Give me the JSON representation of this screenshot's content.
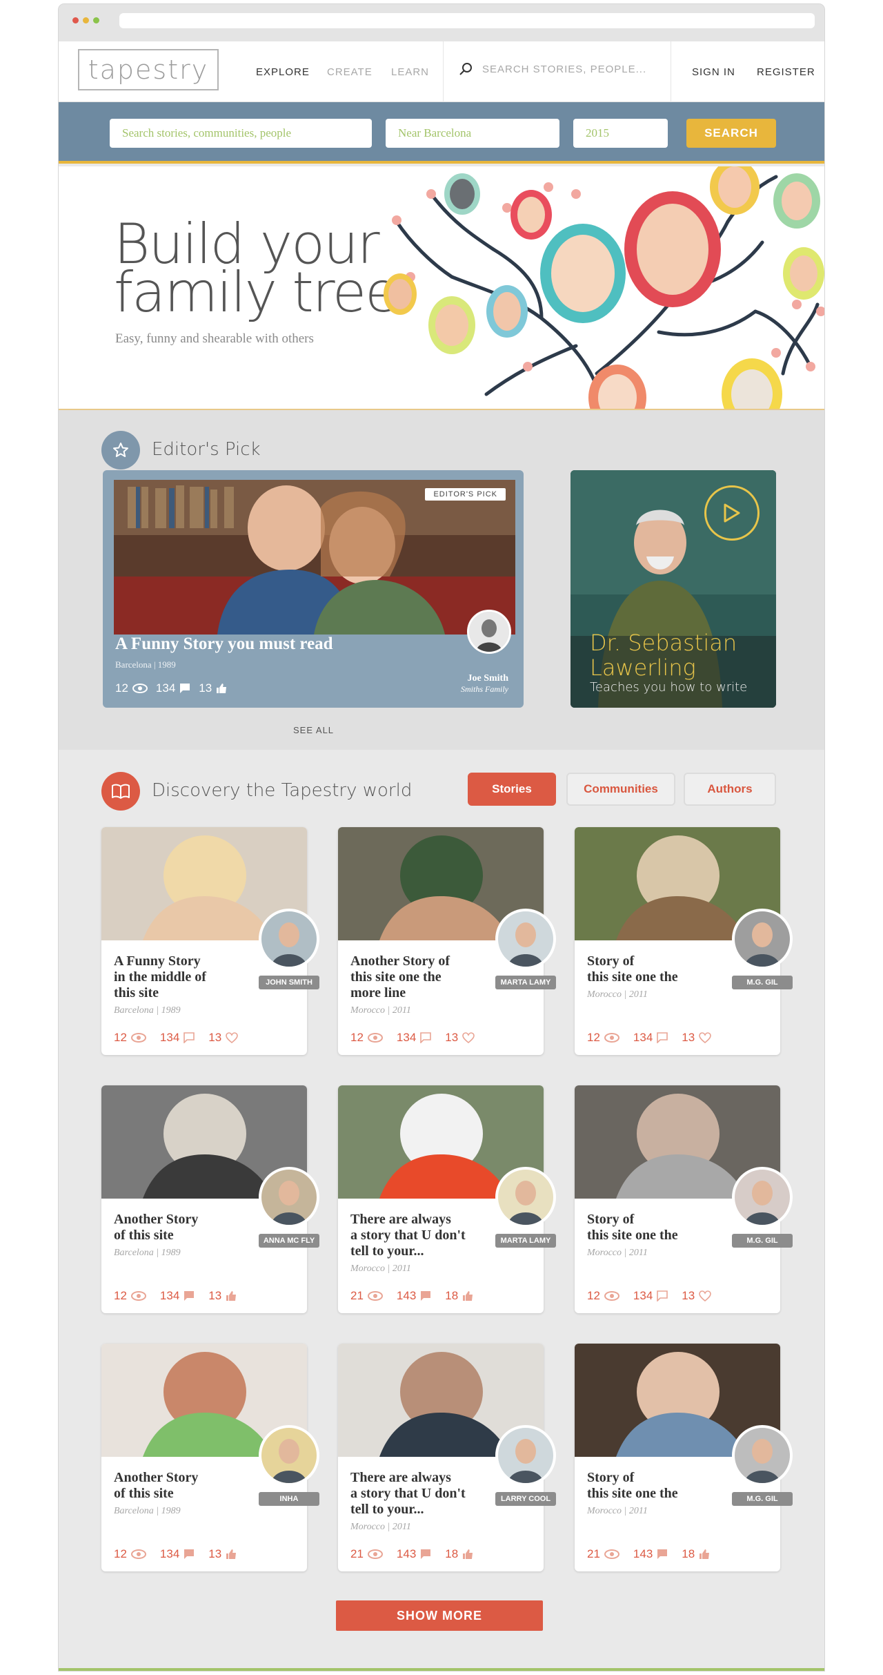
{
  "brand": {
    "logo": "tapestry"
  },
  "nav": {
    "items": [
      {
        "label": "EXPLORE"
      },
      {
        "label": "CREATE"
      },
      {
        "label": "LEARN"
      }
    ],
    "search_placeholder": "SEARCH STORIES, PEOPLE...",
    "sign_in": "SIGN IN",
    "register": "REGISTER"
  },
  "filters": {
    "query_placeholder": "Search stories, communities, people",
    "location_placeholder": "Near Barcelona",
    "year_placeholder": "2015",
    "search_button": "SEARCH"
  },
  "hero": {
    "title": "Build your\nfamily tree",
    "subtitle": "Easy, funny and shearable with others"
  },
  "editors_pick": {
    "heading": "Editor's Pick",
    "featured": {
      "badge": "EDITOR'S PICK",
      "title": "A Funny Story you must read",
      "meta": "Barcelona | 1989",
      "views": "12",
      "comments": "134",
      "likes": "13",
      "author_name": "Joe Smith",
      "author_family": "Smiths Family"
    },
    "video": {
      "name": "Dr. Sebastian\nLawerling",
      "subtitle": "Teaches you how to write"
    },
    "see_all": "SEE ALL"
  },
  "discover": {
    "heading": "Discovery the Tapestry world",
    "tabs": [
      "Stories",
      "Communities",
      "Authors"
    ],
    "cards": [
      {
        "title": "A Funny Story\nin the middle of\nthis site",
        "meta": "Barcelona | 1989",
        "author": "JOHN SMITH",
        "views": "12",
        "comments": "134",
        "likes": "13"
      },
      {
        "title": "Another Story of\nthis site one the\nmore line",
        "meta": "Morocco | 2011",
        "author": "MARTA LAMY",
        "views": "12",
        "comments": "134",
        "likes": "13"
      },
      {
        "title": "Story of\nthis site one the",
        "meta": "Morocco | 2011",
        "author": "M.G. GIL",
        "views": "12",
        "comments": "134",
        "likes": "13"
      },
      {
        "title": "Another Story\nof this site",
        "meta": "Barcelona | 1989",
        "author": "ANNA MC FLY",
        "views": "12",
        "comments": "134",
        "likes": "13"
      },
      {
        "title": "There are always\na story that U don't\ntell to your...",
        "meta": "Morocco | 2011",
        "author": "MARTA LAMY",
        "views": "21",
        "comments": "143",
        "likes": "18"
      },
      {
        "title": "Story of\nthis site one the",
        "meta": "Morocco | 2011",
        "author": "M.G. GIL",
        "views": "12",
        "comments": "134",
        "likes": "13"
      },
      {
        "title": "Another Story\nof this site",
        "meta": "Barcelona | 1989",
        "author": "INHA",
        "views": "12",
        "comments": "134",
        "likes": "13"
      },
      {
        "title": "There are always\na story that U don't\ntell to your...",
        "meta": "Morocco | 2011",
        "author": "LARRY COOL",
        "views": "21",
        "comments": "143",
        "likes": "18"
      },
      {
        "title": "Story of\nthis site one the",
        "meta": "Morocco | 2011",
        "author": "M.G. GIL",
        "views": "21",
        "comments": "143",
        "likes": "18"
      }
    ],
    "show_more": "SHOW MORE"
  },
  "colors": {
    "accent": "#dc5a44",
    "filter_bar": "#6e8aa1",
    "yellow": "#e8b63c",
    "green_text": "#a3c46a"
  }
}
